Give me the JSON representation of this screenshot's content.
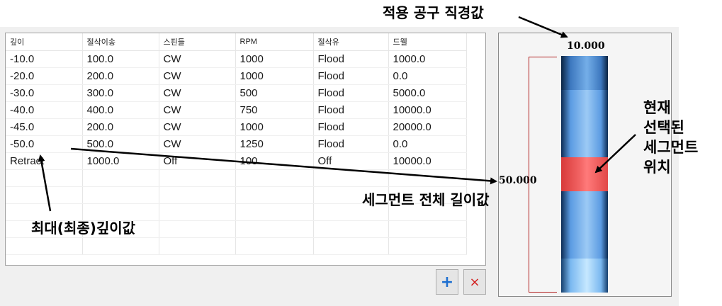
{
  "grid": {
    "columns": [
      "깊이",
      "절삭이송",
      "스핀들",
      "RPM",
      "절삭유",
      "드웰"
    ],
    "rows": [
      [
        "-10.0",
        "100.0",
        "CW",
        "1000",
        "Flood",
        "1000.0"
      ],
      [
        "-20.0",
        "200.0",
        "CW",
        "1000",
        "Flood",
        "0.0"
      ],
      [
        "-30.0",
        "300.0",
        "CW",
        "500",
        "Flood",
        "5000.0"
      ],
      [
        "-40.0",
        "400.0",
        "CW",
        "750",
        "Flood",
        "10000.0"
      ],
      [
        "-45.0",
        "200.0",
        "CW",
        "1000",
        "Flood",
        "20000.0"
      ],
      [
        "-50.0",
        "500.0",
        "CW",
        "1250",
        "Flood",
        "0.0"
      ],
      [
        "Retract",
        "1000.0",
        "Off",
        "100",
        "Off",
        "10000.0"
      ]
    ],
    "empty_rows": 5
  },
  "buttons": {
    "add_glyph": "+",
    "delete_glyph": "×",
    "add_icon": "plus-icon",
    "delete_icon": "close-icon"
  },
  "preview": {
    "tool_diameter": "10.000",
    "total_length": "50.000",
    "selected_segment_index": 3,
    "segment_count": 7
  },
  "annotations": {
    "tool_diameter": "적용 공구 직경값",
    "selected_segment_lines": [
      "현재",
      "선택된",
      "세그먼트",
      "위치"
    ],
    "total_depth": "세그먼트 전체 길이값",
    "max_depth": "최대(최종)깊이값"
  },
  "colors": {
    "selected_segment": "#f26464",
    "tool_segment": "#5b9be2",
    "bracket": "#b02020",
    "add_button": "#1e6fd0",
    "delete_button": "#d32020"
  }
}
